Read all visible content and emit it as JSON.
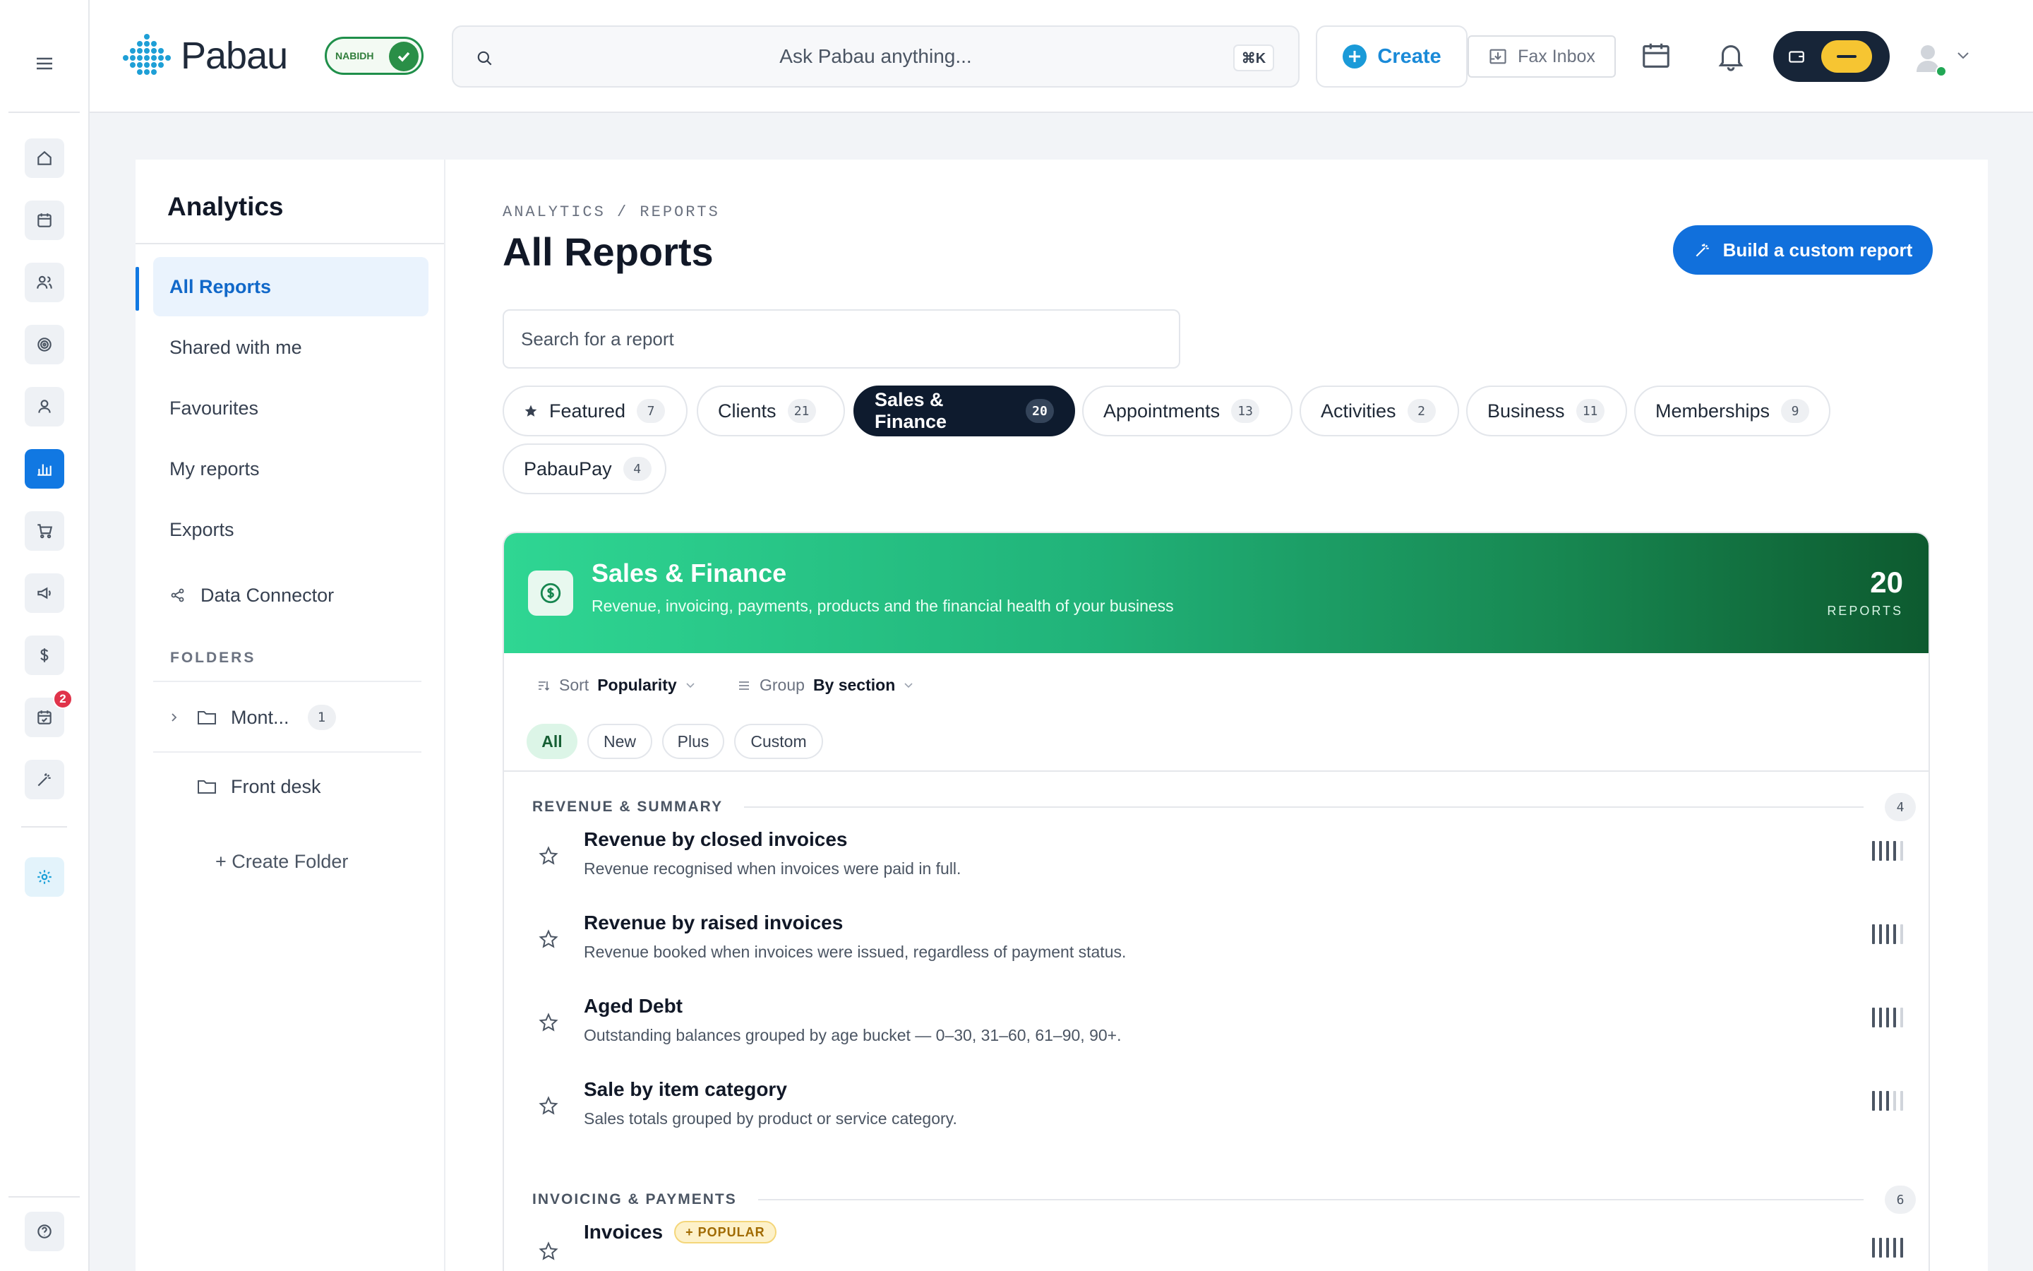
{
  "app": {
    "logo_text": "Pabau",
    "nabidh_label": "NABIDH"
  },
  "topbar": {
    "search_placeholder": "Ask Pabau anything...",
    "shortcut": "⌘K",
    "create_label": "Create",
    "fax_label": "Fax Inbox"
  },
  "rail": {
    "notification_badge": "2"
  },
  "sidebar": {
    "title": "Analytics",
    "items": [
      {
        "label": "All Reports",
        "active": true
      },
      {
        "label": "Shared with me"
      },
      {
        "label": "Favourites"
      },
      {
        "label": "My reports"
      },
      {
        "label": "Exports"
      },
      {
        "label": "Data Connector"
      }
    ],
    "folders_heading": "FOLDERS",
    "folders": [
      {
        "label": "Mont...",
        "count": "1"
      },
      {
        "label": "Front desk"
      }
    ],
    "create_folder": "+ Create Folder"
  },
  "main": {
    "breadcrumb": "ANALYTICS / REPORTS",
    "title": "All Reports",
    "build_button": "Build a custom report",
    "search_placeholder": "Search for a report",
    "categories": [
      {
        "label": "Featured",
        "count": "7",
        "icon": "star-icon"
      },
      {
        "label": "Clients",
        "count": "21"
      },
      {
        "label": "Sales & Finance",
        "count": "20",
        "active": true
      },
      {
        "label": "Appointments",
        "count": "13"
      },
      {
        "label": "Activities",
        "count": "2"
      },
      {
        "label": "Business",
        "count": "11"
      },
      {
        "label": "Memberships",
        "count": "9"
      },
      {
        "label": "PabauPay",
        "count": "4"
      }
    ],
    "section": {
      "title": "Sales & Finance",
      "subtitle": "Revenue, invoicing, payments, products and the financial health of your business",
      "count": "20",
      "count_label": "REPORTS",
      "sort_label": "Sort",
      "sort_value": "Popularity",
      "group_label": "Group",
      "group_value": "By section",
      "filters": [
        "All",
        "New",
        "Plus",
        "Custom"
      ],
      "groups": [
        {
          "heading": "REVENUE & SUMMARY",
          "count": "4",
          "reports": [
            {
              "title": "Revenue by closed invoices",
              "desc": "Revenue recognised when invoices were paid in full.",
              "popularity": 4
            },
            {
              "title": "Revenue by raised invoices",
              "desc": "Revenue booked when invoices were issued, regardless of payment status.",
              "popularity": 4
            },
            {
              "title": "Aged Debt",
              "desc": "Outstanding balances grouped by age bucket — 0–30, 31–60, 61–90, 90+.",
              "popularity": 4
            },
            {
              "title": "Sale by item category",
              "desc": "Sales totals grouped by product or service category.",
              "popularity": 3
            }
          ]
        },
        {
          "heading": "INVOICING & PAYMENTS",
          "count": "6",
          "reports": [
            {
              "title": "Invoices",
              "badge": "+ POPULAR",
              "desc": "",
              "popularity": 5
            }
          ]
        }
      ]
    }
  },
  "colors": {
    "accent": "#1178e2",
    "banner_start": "#2fd693",
    "banner_end": "#0d5a2f",
    "dark_chip": "#0e1b2e"
  }
}
